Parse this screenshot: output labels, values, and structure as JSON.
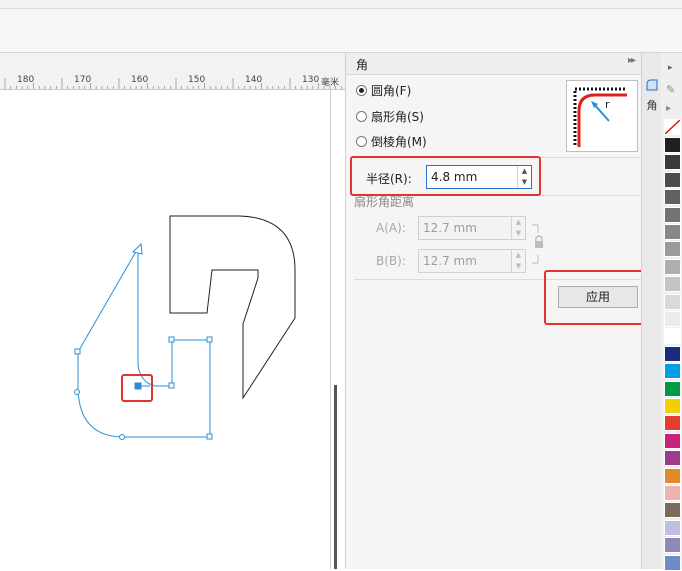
{
  "ruler": {
    "unit": "毫米",
    "ticks": [
      "180",
      "170",
      "160",
      "150",
      "140",
      "130"
    ]
  },
  "panel": {
    "title": "角",
    "expand_icon": "▸▸",
    "close_icon": "✕",
    "options": [
      {
        "label": "圆角(F)",
        "checked": true
      },
      {
        "label": "扇形角(S)",
        "checked": false
      },
      {
        "label": "倒棱角(M)",
        "checked": false
      }
    ],
    "preview_label": "r",
    "radius": {
      "label": "半径(R):",
      "value": "4.8 mm"
    },
    "scallop": {
      "heading": "扇形角距离",
      "a": {
        "label": "A(A):",
        "value": "12.7 mm"
      },
      "b": {
        "label": "B(B):",
        "value": "12.7 mm"
      }
    },
    "apply_label": "应用"
  },
  "tabs": {
    "corner_tab": "角"
  },
  "palette": {
    "swatches": [
      "#231f20",
      "#3a3a3a",
      "#4d4d4d",
      "#606060",
      "#737373",
      "#878787",
      "#9b9b9b",
      "#afafaf",
      "#c4c4c4",
      "#d9d9d9",
      "#ececec",
      "#ffffff",
      "#1d2a7a",
      "#009fe3",
      "#009a44",
      "#f0d000",
      "#e43d2f",
      "#c8237e",
      "#9e3c8b",
      "#e08a2c",
      "#efb2b2",
      "#7b6b5a",
      "#c0bfe0",
      "#8d89b8",
      "#6c8cc8"
    ]
  },
  "colors": {
    "accent": "#2a6fd6",
    "highlight": "#e53333",
    "selection": "#2b8fd6"
  }
}
